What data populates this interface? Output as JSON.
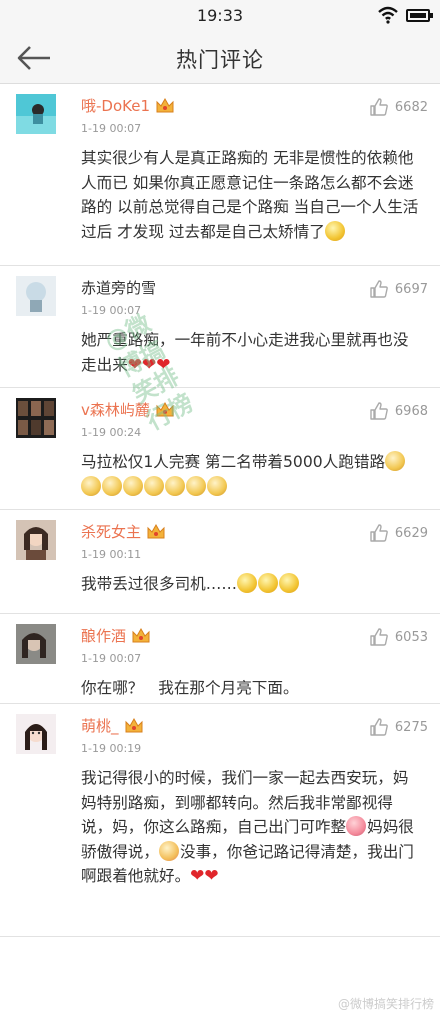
{
  "status_bar": {
    "time": "19:33"
  },
  "header": {
    "title": "热门评论",
    "back_icon": "back-arrow-icon"
  },
  "comments": [
    {
      "username": "哦-DoKe1",
      "vip": true,
      "timestamp": "1-19 00:07",
      "likes": "6682",
      "text": "其实很少有人是真正路痴的 无非是惯性的依赖他人而已 如果你真正愿意记住一条路怎么都不会迷路的  以前总觉得自己是个路痴 当自己一个人生活过后 才发现 过去都是自己太矫情了",
      "emoji": [
        "smile"
      ]
    },
    {
      "username": "赤道旁的雪",
      "vip": false,
      "timestamp": "1-19 00:07",
      "likes": "6697",
      "text": "她严重路痴，一年前不小心走进我心里就再也没走出来",
      "emoji": [
        "heart",
        "heart",
        "heart"
      ]
    },
    {
      "username": "v森林屿麓",
      "vip": true,
      "timestamp": "1-19 00:24",
      "likes": "6968",
      "text": "马拉松仅1人完赛 第二名带着5000人跑错路",
      "emoji": [
        "dog",
        "dog",
        "dog",
        "dog",
        "dog",
        "dog",
        "dog",
        "dog"
      ]
    },
    {
      "username": "杀死女主",
      "vip": true,
      "timestamp": "1-19 00:11",
      "likes": "6629",
      "text": "我带丢过很多司机……",
      "emoji": [
        "smile",
        "smile",
        "smile"
      ]
    },
    {
      "username": "酿作酒",
      "vip": true,
      "timestamp": "1-19 00:07",
      "likes": "6053",
      "text": "你在哪？   我在那个月亮下面。",
      "emoji": []
    },
    {
      "username": "萌桃_",
      "vip": true,
      "timestamp": "1-19 00:19",
      "likes": "6275",
      "text_parts": [
        "我记得很小的时候，我们一家一起去西安玩，妈妈特别路痴，到哪都转向。然后我非常鄙视得说，妈，你这么路痴，自己出门可咋整",
        "妈妈很骄傲得说，",
        "没事，你爸记路记得清楚，我出门啊跟着他就好。"
      ],
      "inline_emoji": [
        "pig",
        "blush"
      ],
      "emoji": [
        "heart",
        "heart"
      ]
    }
  ],
  "watermark": {
    "center": "@微博搞笑排行榜",
    "footer": "@微博搞笑排行榜"
  }
}
